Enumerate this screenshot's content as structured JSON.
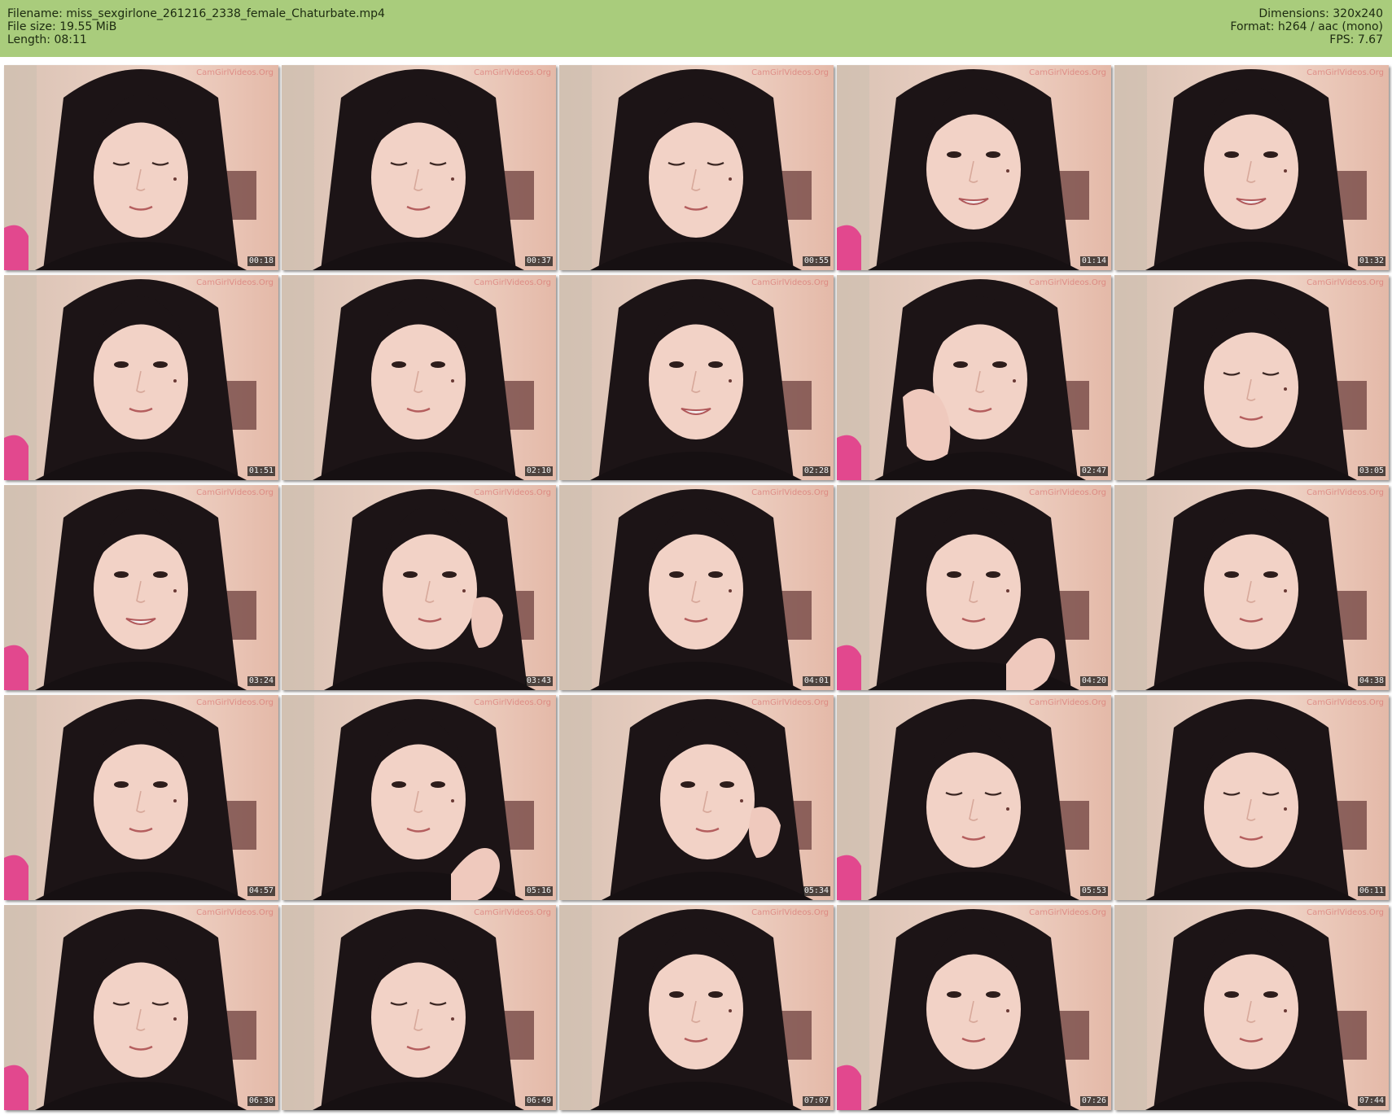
{
  "header": {
    "filename_line": "Filename: miss_sexgirlone_261216_2338_female_Chaturbate.mp4",
    "filesize_line": "File size: 19.55 MiB",
    "length_line": "Length: 08:11",
    "dimensions_line": "Dimensions: 320x240",
    "format_line": "Format: h264 / aac (mono)",
    "fps_line": "FPS: 7.67"
  },
  "watermark": "CamGirlVideos.Org",
  "colors": {
    "header_bg": "#a9cc7c",
    "page_bg": "#ffffff",
    "timestamp_bg": "#141414",
    "timestamp_text": "#f2f2f2"
  },
  "thumbnails": [
    {
      "time": "00:18",
      "pose": "down"
    },
    {
      "time": "00:37",
      "pose": "down"
    },
    {
      "time": "00:55",
      "pose": "down"
    },
    {
      "time": "01:14",
      "pose": "smile"
    },
    {
      "time": "01:32",
      "pose": "smile"
    },
    {
      "time": "01:51",
      "pose": "neutral"
    },
    {
      "time": "02:10",
      "pose": "neutral"
    },
    {
      "time": "02:28",
      "pose": "smile"
    },
    {
      "time": "02:47",
      "pose": "hand-left"
    },
    {
      "time": "03:05",
      "pose": "down"
    },
    {
      "time": "03:24",
      "pose": "smile"
    },
    {
      "time": "03:43",
      "pose": "tilt-hand"
    },
    {
      "time": "04:01",
      "pose": "neutral"
    },
    {
      "time": "04:20",
      "pose": "hand-right"
    },
    {
      "time": "04:38",
      "pose": "neutral"
    },
    {
      "time": "04:57",
      "pose": "neutral"
    },
    {
      "time": "05:16",
      "pose": "hand-right"
    },
    {
      "time": "05:34",
      "pose": "tilt-hand"
    },
    {
      "time": "05:53",
      "pose": "down"
    },
    {
      "time": "06:11",
      "pose": "down"
    },
    {
      "time": "06:30",
      "pose": "down"
    },
    {
      "time": "06:49",
      "pose": "down"
    },
    {
      "time": "07:07",
      "pose": "neutral"
    },
    {
      "time": "07:26",
      "pose": "neutral"
    },
    {
      "time": "07:44",
      "pose": "neutral"
    }
  ]
}
